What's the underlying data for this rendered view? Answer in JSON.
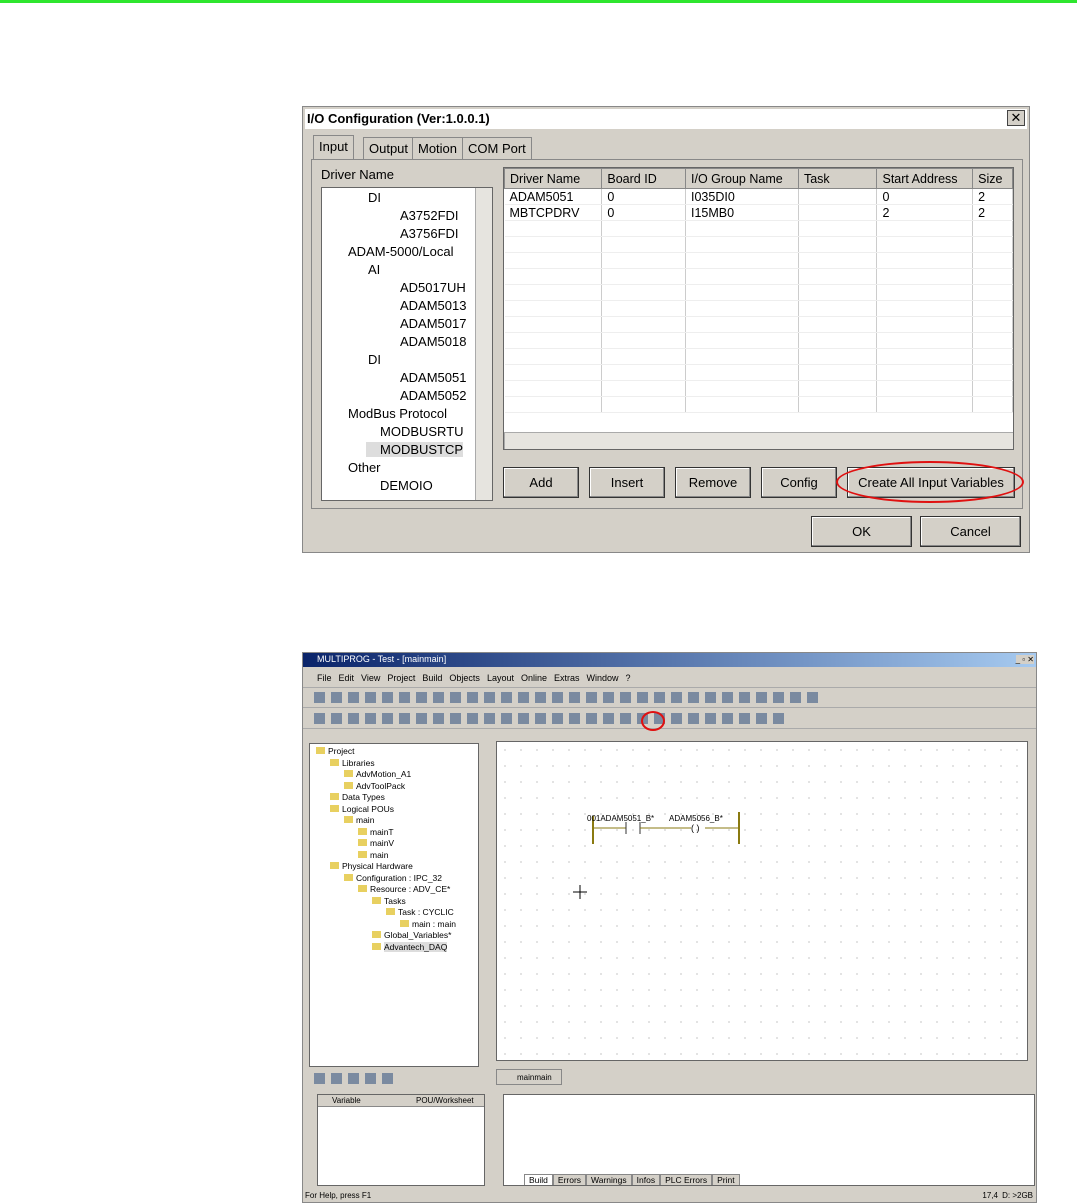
{
  "dialog": {
    "title": "I/O Configuration (Ver:1.0.0.1)",
    "tabs": [
      "Input",
      "Output",
      "Motion",
      "COM Port"
    ],
    "driver_label": "Driver Name",
    "tree": [
      {
        "t": "DI",
        "l": 1,
        "box": true
      },
      {
        "t": "A3752FDI",
        "l": 2
      },
      {
        "t": "A3756FDI",
        "l": 2
      },
      {
        "t": "ADAM-5000/Local",
        "l": 0,
        "box": true
      },
      {
        "t": "AI",
        "l": 1,
        "box": true
      },
      {
        "t": "AD5017UH",
        "l": 2
      },
      {
        "t": "ADAM5013",
        "l": 2
      },
      {
        "t": "ADAM5017",
        "l": 2
      },
      {
        "t": "ADAM5018",
        "l": 2
      },
      {
        "t": "DI",
        "l": 1,
        "box": true
      },
      {
        "t": "ADAM5051",
        "l": 2
      },
      {
        "t": "ADAM5052",
        "l": 2
      },
      {
        "t": "ModBus Protocol",
        "l": 0,
        "box": true
      },
      {
        "t": "MODBUSRTU",
        "l": 1
      },
      {
        "t": "MODBUSTCP",
        "l": 1,
        "sel": true
      },
      {
        "t": "Other",
        "l": 0,
        "box": true
      },
      {
        "t": "DEMOIO",
        "l": 1
      }
    ],
    "columns": [
      "Driver Name",
      "Board ID",
      "I/O Group Name",
      "Task",
      "Start Address",
      "Size"
    ],
    "rows": [
      [
        "ADAM5051",
        "0",
        "I035DI0",
        "",
        "0",
        "2"
      ],
      [
        "MBTCPDRV",
        "0",
        "I15MB0",
        "",
        "2",
        "2"
      ]
    ],
    "buttons": {
      "add": "Add",
      "insert": "Insert",
      "remove": "Remove",
      "config": "Config",
      "create": "Create All Input Variables",
      "ok": "OK",
      "cancel": "Cancel"
    }
  },
  "app": {
    "title": "MULTIPROG - Test - [mainmain]",
    "menu": [
      "File",
      "Edit",
      "View",
      "Project",
      "Build",
      "Objects",
      "Layout",
      "Online",
      "Extras",
      "Window",
      "?"
    ],
    "tree": [
      {
        "t": "Project",
        "l": 0
      },
      {
        "t": "Libraries",
        "l": 1
      },
      {
        "t": "AdvMotion_A1",
        "l": 2
      },
      {
        "t": "AdvToolPack",
        "l": 2
      },
      {
        "t": "Data Types",
        "l": 1
      },
      {
        "t": "Logical POUs",
        "l": 1
      },
      {
        "t": "main",
        "l": 2
      },
      {
        "t": "mainT",
        "l": 3
      },
      {
        "t": "mainV",
        "l": 3
      },
      {
        "t": "main",
        "l": 3
      },
      {
        "t": "Physical Hardware",
        "l": 1
      },
      {
        "t": "Configuration : IPC_32",
        "l": 2
      },
      {
        "t": "Resource : ADV_CE*",
        "l": 3
      },
      {
        "t": "Tasks",
        "l": 4
      },
      {
        "t": "Task : CYCLIC",
        "l": 5
      },
      {
        "t": "main : main",
        "l": 6
      },
      {
        "t": "Global_Variables*",
        "l": 4
      },
      {
        "t": "Advantech_DAQ",
        "l": 4,
        "sel": true
      }
    ],
    "contact_label": "001ADAM5051_B*",
    "coil_label": "ADAM5056_B*",
    "doc_tab": "mainmain",
    "var_columns": [
      "Variable",
      "POU/Worksheet"
    ],
    "msg_tabs": [
      "Build",
      "Errors",
      "Warnings",
      "Infos",
      "PLC Errors",
      "Print"
    ],
    "status": "For Help, press F1",
    "pos": "17,4",
    "disk": "D: >2GB"
  }
}
